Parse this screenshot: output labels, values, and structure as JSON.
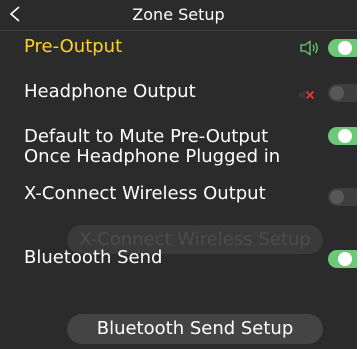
{
  "header": {
    "title": "Zone Setup"
  },
  "rows": {
    "pre_output": {
      "label": "Pre-Output",
      "toggle": "on",
      "icon": "speaker-icon"
    },
    "headphone_output": {
      "label": "Headphone Output",
      "toggle": "off",
      "icon": "mute-icon"
    },
    "default_mute": {
      "label": "Default to Mute Pre-Output Once Headphone Plugged in",
      "toggle": "on"
    },
    "xconnect": {
      "label": "X-Connect Wireless Output",
      "toggle": "off"
    },
    "bluetooth_send": {
      "label": "Bluetooth Send",
      "toggle": "on"
    }
  },
  "buttons": {
    "xconnect_setup": {
      "label": "X-Connect Wireless Setup",
      "enabled": false
    },
    "bluetooth_setup": {
      "label": "Bluetooth Send Setup",
      "enabled": true
    }
  },
  "colors": {
    "active_text": "#ffd21f",
    "toggle_on": "#6dc979",
    "mute_red": "#e53935",
    "background": "#2b2b2b"
  }
}
